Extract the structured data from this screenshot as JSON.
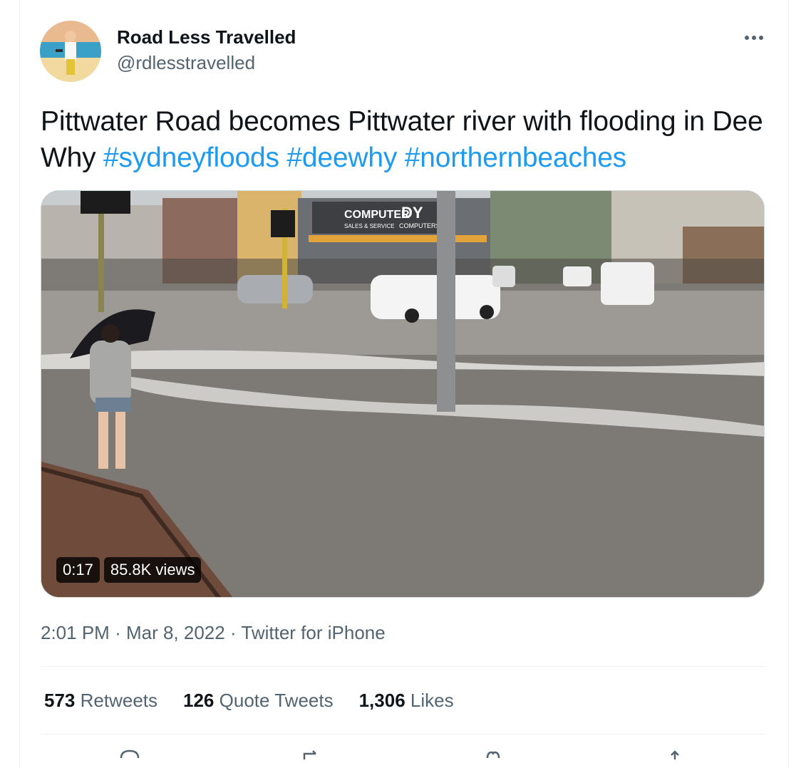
{
  "author": {
    "name": "Road Less Travelled",
    "handle": "@rdlesstravelled",
    "avatar_icon": "profile-photo"
  },
  "tweet": {
    "text": "Pittwater Road becomes Pittwater river with flooding in Dee Why",
    "hashtags": [
      "#sydneyfloods",
      "#deewhy",
      "#northernbeaches"
    ]
  },
  "media": {
    "type": "video",
    "duration": "0:17",
    "views": "85.8K views",
    "shop_sign_1": "COMPUTER",
    "shop_sign_2": "DY",
    "shop_sign_3": "SALES & SERVICE",
    "shop_sign_4": "COMPUTERS"
  },
  "meta": {
    "time": "2:01 PM",
    "date": "Mar 8, 2022",
    "source": "Twitter for iPhone",
    "separator": "·"
  },
  "stats": [
    {
      "count": "573",
      "label": "Retweets"
    },
    {
      "count": "126",
      "label": "Quote Tweets"
    },
    {
      "count": "1,306",
      "label": "Likes"
    }
  ],
  "colors": {
    "link": "#1d9bf0",
    "secondary_text": "#536471",
    "primary_text": "#0f1419",
    "border": "#eff3f4"
  },
  "actions": [
    "reply-icon",
    "retweet-icon",
    "like-icon",
    "share-icon"
  ]
}
